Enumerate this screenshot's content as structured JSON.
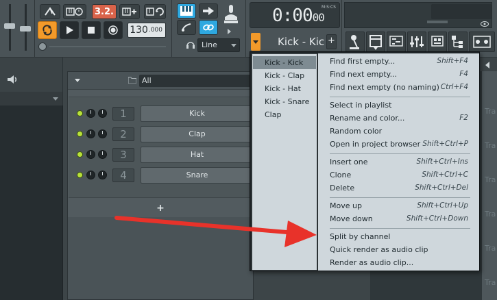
{
  "toolbar": {
    "step_edit_label": "3.2.",
    "tempo": {
      "int": "130",
      "dec": ".000"
    },
    "snap_value": "Line",
    "time_display": {
      "main": "0:00",
      "cs": "00",
      "format_label": "M:S:CS"
    },
    "pattern_name": "Kick - Kick",
    "add_pattern_label": "+"
  },
  "channel_rack": {
    "group_filter": "All",
    "add_label": "+",
    "channels": [
      {
        "number": "1",
        "name": "Kick"
      },
      {
        "number": "2",
        "name": "Clap"
      },
      {
        "number": "3",
        "name": "Hat"
      },
      {
        "number": "4",
        "name": "Snare"
      }
    ]
  },
  "playlist": {
    "track_labels": [
      "Tra",
      "Tra",
      "Tra",
      "Tra",
      "Tra",
      "Tra",
      "Tra"
    ]
  },
  "menu": {
    "patterns": [
      {
        "label": "Kick - Kick",
        "selected": true
      },
      {
        "label": "Kick - Clap",
        "selected": false
      },
      {
        "label": "Kick - Hat",
        "selected": false
      },
      {
        "label": "Kick - Snare",
        "selected": false
      },
      {
        "label": "Clap",
        "selected": false
      }
    ],
    "items": [
      {
        "label": "Find first empty...",
        "shortcut": "Shift+F4"
      },
      {
        "label": "Find next empty...",
        "shortcut": "F4"
      },
      {
        "label": "Find next empty (no naming)",
        "shortcut": "Ctrl+F4"
      },
      {
        "label": "Select in playlist",
        "shortcut": ""
      },
      {
        "label": "Rename and color...",
        "shortcut": "F2"
      },
      {
        "label": "Random color",
        "shortcut": ""
      },
      {
        "label": "Open in project browser",
        "shortcut": "Shift+Ctrl+P"
      },
      {
        "label": "Insert one",
        "shortcut": "Shift+Ctrl+Ins"
      },
      {
        "label": "Clone",
        "shortcut": "Shift+Ctrl+C"
      },
      {
        "label": "Delete",
        "shortcut": "Shift+Ctrl+Del"
      },
      {
        "label": "Move up",
        "shortcut": "Shift+Ctrl+Up"
      },
      {
        "label": "Move down",
        "shortcut": "Shift+Ctrl+Down"
      },
      {
        "label": "Split by channel",
        "shortcut": ""
      },
      {
        "label": "Quick render as audio clip",
        "shortcut": ""
      },
      {
        "label": "Render as audio clip...",
        "shortcut": ""
      }
    ]
  },
  "colors": {
    "accent_orange": "#f39a2a",
    "accent_blue": "#2ea8e0",
    "step_edit_red": "#d9634a",
    "channel_led_green": "#b8e13a",
    "annotation_arrow_red": "#e8322a",
    "menu_background": "#cfd7dc"
  }
}
